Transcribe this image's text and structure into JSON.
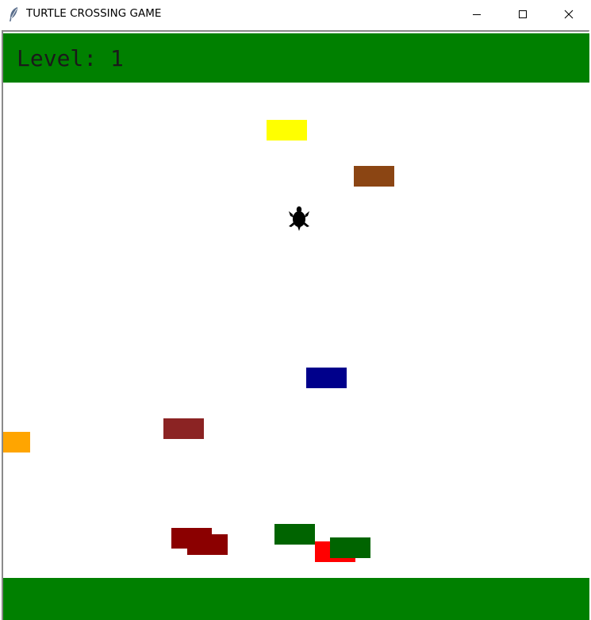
{
  "window": {
    "title": "TURTLE CROSSING GAME",
    "controls": {
      "minimize": "minimize-icon",
      "maximize": "maximize-icon",
      "close": "close-icon"
    }
  },
  "game": {
    "level_text": "Level: 1",
    "colors": {
      "strip": "#008000",
      "background": "#ffffff",
      "turtle": "#000000"
    },
    "cars": [
      {
        "color": "#ffff00"
      },
      {
        "color": "#8b4513"
      },
      {
        "color": "#00008b"
      },
      {
        "color": "#8b2323"
      },
      {
        "color": "#ffa500"
      },
      {
        "color": "#8b0000"
      },
      {
        "color": "#8b0000"
      },
      {
        "color": "#006400"
      },
      {
        "color": "#ff0000"
      },
      {
        "color": "#006400"
      }
    ]
  }
}
